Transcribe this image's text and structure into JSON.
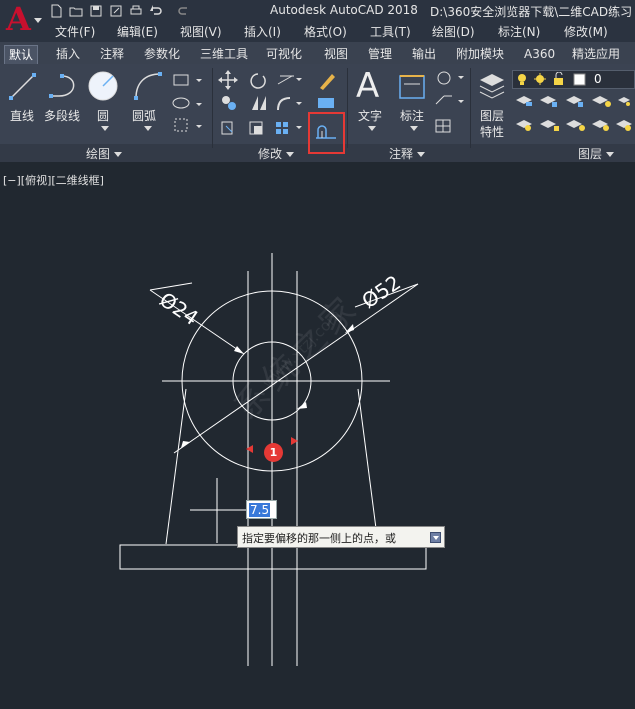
{
  "titlebar": {
    "app_title": "Autodesk AutoCAD 2018",
    "document_path": "D:\\360安全浏览器下载\\二维CAD练习"
  },
  "menus": [
    "文件(F)",
    "编辑(E)",
    "视图(V)",
    "插入(I)",
    "格式(O)",
    "工具(T)",
    "绘图(D)",
    "标注(N)",
    "修改(M)"
  ],
  "tabs": [
    "默认",
    "插入",
    "注释",
    "参数化",
    "三维工具",
    "可视化",
    "视图",
    "管理",
    "输出",
    "附加模块",
    "A360",
    "精选应用"
  ],
  "ribbon": {
    "draw": {
      "line": "直线",
      "polyline": "多段线",
      "circle": "圆",
      "arc": "圆弧",
      "panel_label": "绘图"
    },
    "modify": {
      "panel_label": "修改"
    },
    "annotation": {
      "text": "文字",
      "dimension": "标注",
      "panel_label": "注释"
    },
    "layers": {
      "layer_props_line1": "图层",
      "layer_props_line2": "特性",
      "panel_label": "图层",
      "current_layer": "0"
    }
  },
  "viewport": {
    "label": "[−][俯视][二维线框]"
  },
  "drawing": {
    "dim_small": "Ø24",
    "dim_large": "Ø52",
    "offset_value": "7.5",
    "prompt": "指定要偏移的那一侧上的点，或",
    "step_marker": "1"
  },
  "colors": {
    "canvas": "#212830",
    "ribbon": "#3b4352",
    "highlight": "#e53935",
    "geometry": "#ffffff",
    "grip": "#e53935"
  }
}
